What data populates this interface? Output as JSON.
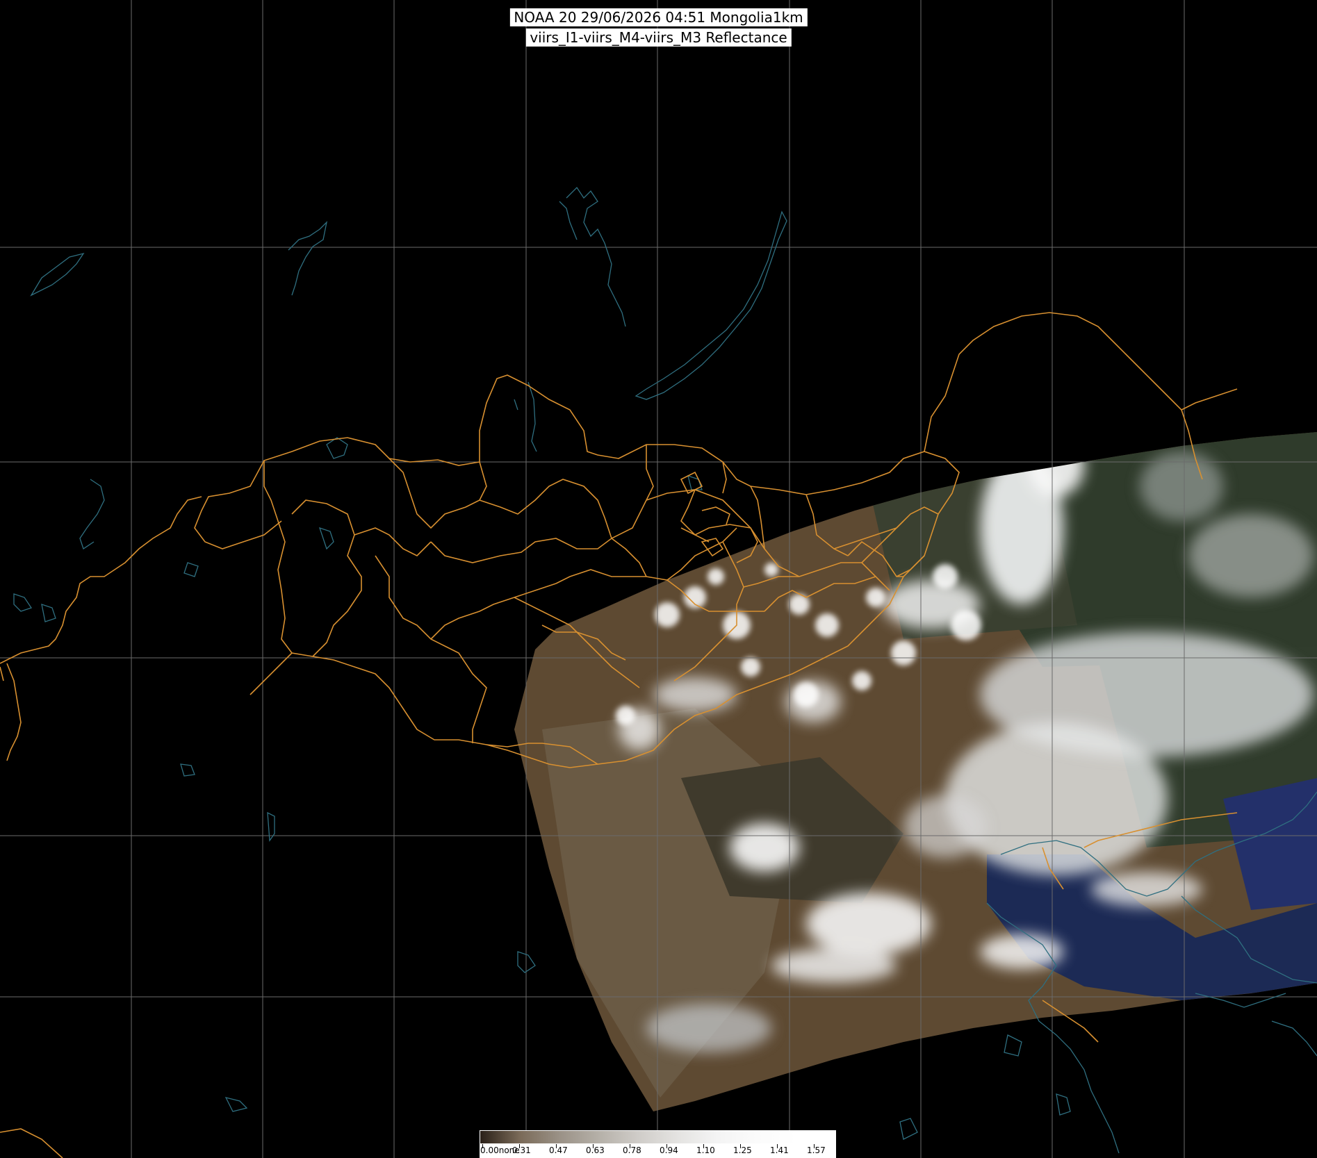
{
  "title": {
    "line1": "NOAA 20 29/06/2026 04:51 Mongolia1km",
    "line2": "viirs_I1-viirs_M4-viirs_M3 Reflectance"
  },
  "colorbar": {
    "labels": [
      "0.00none",
      "0.31",
      "0.47",
      "0.63",
      "0.78",
      "0.94",
      "1.10",
      "1.25",
      "1.41",
      "1.57"
    ],
    "colors": [
      "#2a2018",
      "#7a6a58",
      "#9a9186",
      "#b5b0a8",
      "#cfccc8",
      "#e4e3e1",
      "#f4f4f4",
      "#fbfbfb",
      "#ffffff",
      "#ffffff"
    ]
  },
  "colors": {
    "background": "#000000",
    "grid": "#6b6b6b",
    "borders": "#d89030",
    "coastlines": "#2f6f80",
    "land": "#6b5538",
    "cloud": "#e8ecee",
    "vegetation": "#3d4a35",
    "sea": "#1c2a55"
  }
}
